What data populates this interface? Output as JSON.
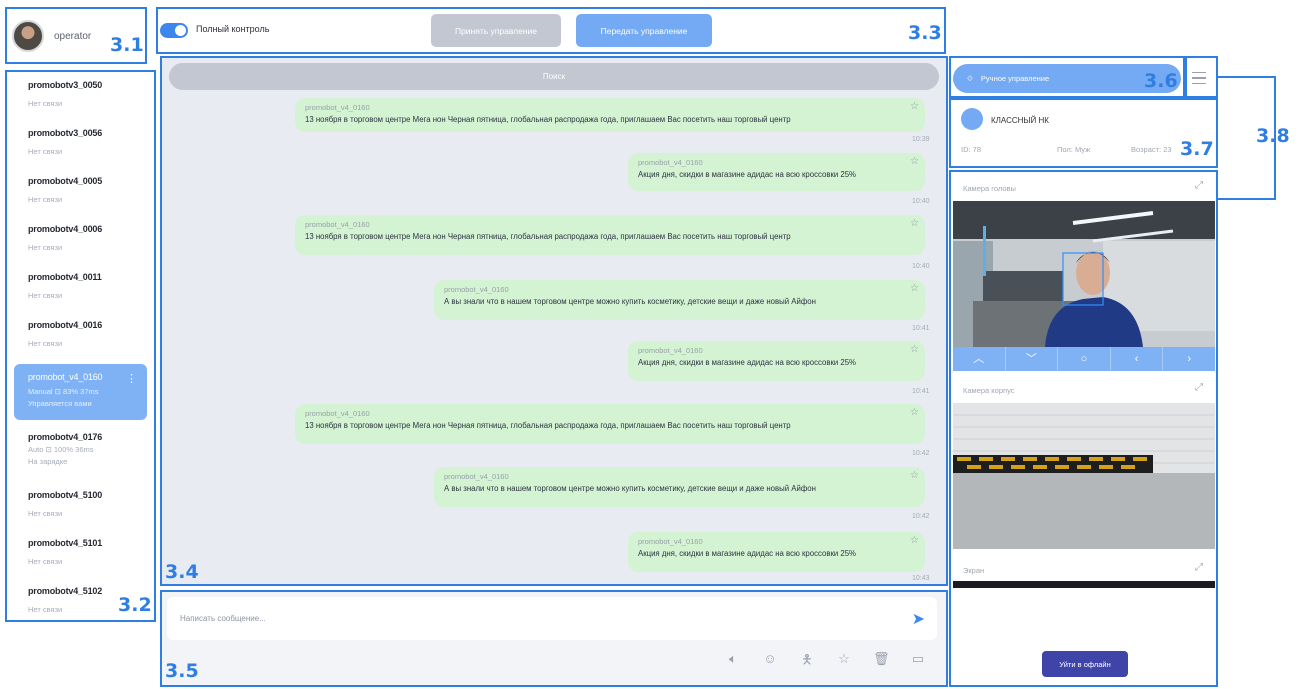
{
  "user": {
    "name": "operator"
  },
  "robots": [
    {
      "name": "promobotv3_0050",
      "status": "Нет связи"
    },
    {
      "name": "promobotv3_0056",
      "status": "Нет связи"
    },
    {
      "name": "promobotv4_0005",
      "status": "Нет связи"
    },
    {
      "name": "promobotv4_0006",
      "status": "Нет связи"
    },
    {
      "name": "promobotv4_0011",
      "status": "Нет связи"
    },
    {
      "name": "promobotv4_0016",
      "status": "Нет связи"
    },
    {
      "name": "promobot_v4_0160",
      "status": "Manual ⊡ 83%  37ms",
      "status2": "Управляется вами",
      "active": true
    },
    {
      "name": "promobotv4_0176",
      "status": "Auto ⊡ 100%  36ms",
      "status2": "На зарядке"
    },
    {
      "name": "promobotv4_5100",
      "status": "Нет связи"
    },
    {
      "name": "promobotv4_5101",
      "status": "Нет связи"
    },
    {
      "name": "promobotv4_5102",
      "status": "Нет связи"
    }
  ],
  "topbar": {
    "toggle_label": "Полный контроль",
    "take_control": "Принять управление",
    "pass_control": "Передать управление"
  },
  "chat": {
    "search": "Поиск",
    "messages": [
      {
        "sender": "promobot_v4_0160",
        "text": "13 ноября в торговом центре Мега нон Черная пятница, глобальная распродажа года, приглашаем Вас посетить наш торговый центр",
        "time": "10:39"
      },
      {
        "sender": "promobot_v4_0160",
        "text": "Акция дня, скидки в магазине адидас на всю кроссовки 25%",
        "time": "10:40"
      },
      {
        "sender": "promobot_v4_0160",
        "text": "13 ноября в торговом центре Мега нон Черная пятница, глобальная распродажа года, приглашаем Вас посетить наш торговый центр",
        "time": "10:40"
      },
      {
        "sender": "promobot_v4_0160",
        "text": "А вы знали что в нашем торговом центре можно купить косметику, детские вещи и даже новый Айфон",
        "time": "10:41"
      },
      {
        "sender": "promobot_v4_0160",
        "text": "Акция дня, скидки в магазине адидас на всю кроссовки 25%",
        "time": "10:41"
      },
      {
        "sender": "promobot_v4_0160",
        "text": "13 ноября в торговом центре Мега нон Черная пятница, глобальная распродажа года, приглашаем Вас посетить наш торговый центр",
        "time": "10:42"
      },
      {
        "sender": "promobot_v4_0160",
        "text": "А вы знали что в нашем торговом центре можно купить косметику, детские вещи и даже новый Айфон",
        "time": "10:42"
      },
      {
        "sender": "promobot_v4_0160",
        "text": "Акция дня, скидки в магазине адидас на всю кроссовки 25%",
        "time": "10:43"
      }
    ]
  },
  "composer": {
    "placeholder": "Написать сообщение..."
  },
  "right": {
    "control_button": "Ручное управление",
    "visitor": {
      "name": "КЛАССНЫЙ НК",
      "id": "ID: 78",
      "sex": "Пол: Муж",
      "age": "Возраст: 23"
    },
    "cam_head_title": "Камера головы",
    "cam_body_title": "Камера корпус",
    "screen_title": "Экран",
    "go_button": "Уйти в офлайн"
  },
  "labels": {
    "l31": "3.1",
    "l32": "3.2",
    "l33": "3.3",
    "l34": "3.4",
    "l35": "3.5",
    "l36": "3.6",
    "l37": "3.7",
    "l38": "3.8"
  },
  "colors": {
    "accent": "#3d86ee",
    "annotation": "#2f7fe3",
    "bubble": "#d3f3d3",
    "chat_bg": "#e8ebf2",
    "active_row": "#7fb1f5",
    "offline_button": "#3e44a8"
  },
  "icons": [
    "send-icon",
    "volume-icon",
    "emoji-icon",
    "gesture-icon",
    "star-icon",
    "trash-icon",
    "screen-icon",
    "joystick-icon",
    "menu-icon",
    "expand-icon"
  ]
}
